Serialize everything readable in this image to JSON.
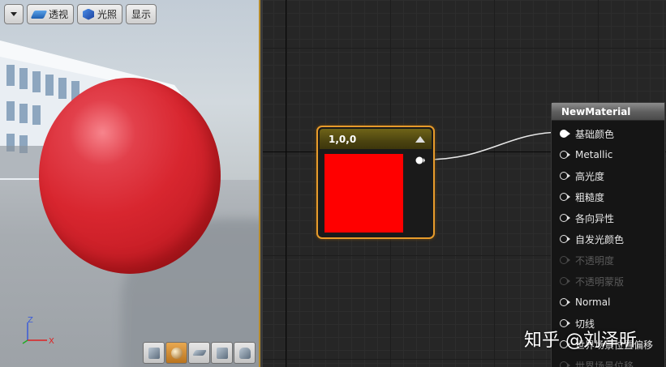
{
  "viewport": {
    "toolbar": {
      "menu_icon": "chevron-down-icon",
      "perspective_label": "透视",
      "lit_label": "光照",
      "show_label": "显示"
    },
    "axis": {
      "z": "Z",
      "x": "X"
    },
    "preview_shapes": [
      "cylinder-icon",
      "sphere-icon",
      "plane-icon",
      "cube-icon",
      "teapot-icon"
    ],
    "active_shape": "sphere-icon",
    "sphere_color": "#d8262f"
  },
  "graph": {
    "constant_node": {
      "title": "1,0,0",
      "color": "#ff0000",
      "border_color": "#e79b2b"
    },
    "material_node": {
      "title": "NewMaterial",
      "pins": [
        {
          "label": "基础颜色",
          "connected": true,
          "enabled": true
        },
        {
          "label": "Metallic",
          "connected": false,
          "enabled": true
        },
        {
          "label": "高光度",
          "connected": false,
          "enabled": true
        },
        {
          "label": "粗糙度",
          "connected": false,
          "enabled": true
        },
        {
          "label": "各向异性",
          "connected": false,
          "enabled": true
        },
        {
          "label": "自发光颜色",
          "connected": false,
          "enabled": true
        },
        {
          "label": "不透明度",
          "connected": false,
          "enabled": false
        },
        {
          "label": "不透明蒙版",
          "connected": false,
          "enabled": false
        },
        {
          "label": "Normal",
          "connected": false,
          "enabled": true
        },
        {
          "label": "切线",
          "connected": false,
          "enabled": true
        },
        {
          "label": "世界场景位置偏移",
          "connected": false,
          "enabled": true
        },
        {
          "label": "世界场景位移",
          "connected": false,
          "enabled": false
        }
      ]
    }
  },
  "watermark": "知乎 @刘泽昕"
}
